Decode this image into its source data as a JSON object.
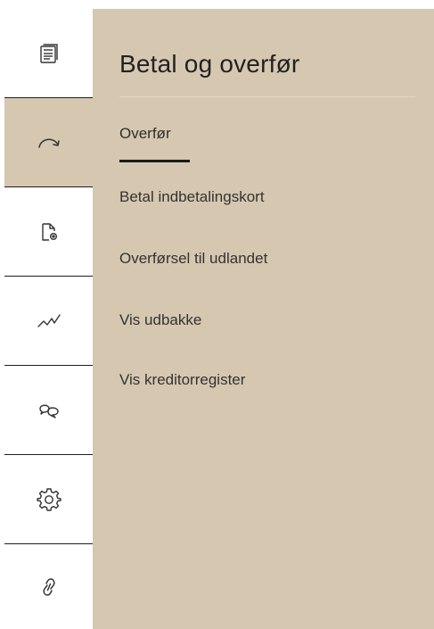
{
  "nav_rail": {
    "items": [
      {
        "icon": "news-icon",
        "active": false
      },
      {
        "icon": "transfer-arrow-icon",
        "active": true
      },
      {
        "icon": "document-settings-icon",
        "active": false
      },
      {
        "icon": "chart-line-icon",
        "active": false
      },
      {
        "icon": "chat-bubbles-icon",
        "active": false
      },
      {
        "icon": "gear-icon",
        "active": false
      },
      {
        "icon": "link-icon",
        "active": false
      }
    ]
  },
  "panel": {
    "title": "Betal og overfør",
    "background": "#d6c7b0",
    "menu": [
      {
        "label": "Overfør",
        "active": true
      },
      {
        "label": "Betal indbetalingskort",
        "active": false
      },
      {
        "label": "Overførsel til udlandet",
        "active": false
      },
      {
        "label": "Vis udbakke",
        "active": false
      },
      {
        "label": "Vis kreditorregister",
        "active": false
      }
    ]
  }
}
